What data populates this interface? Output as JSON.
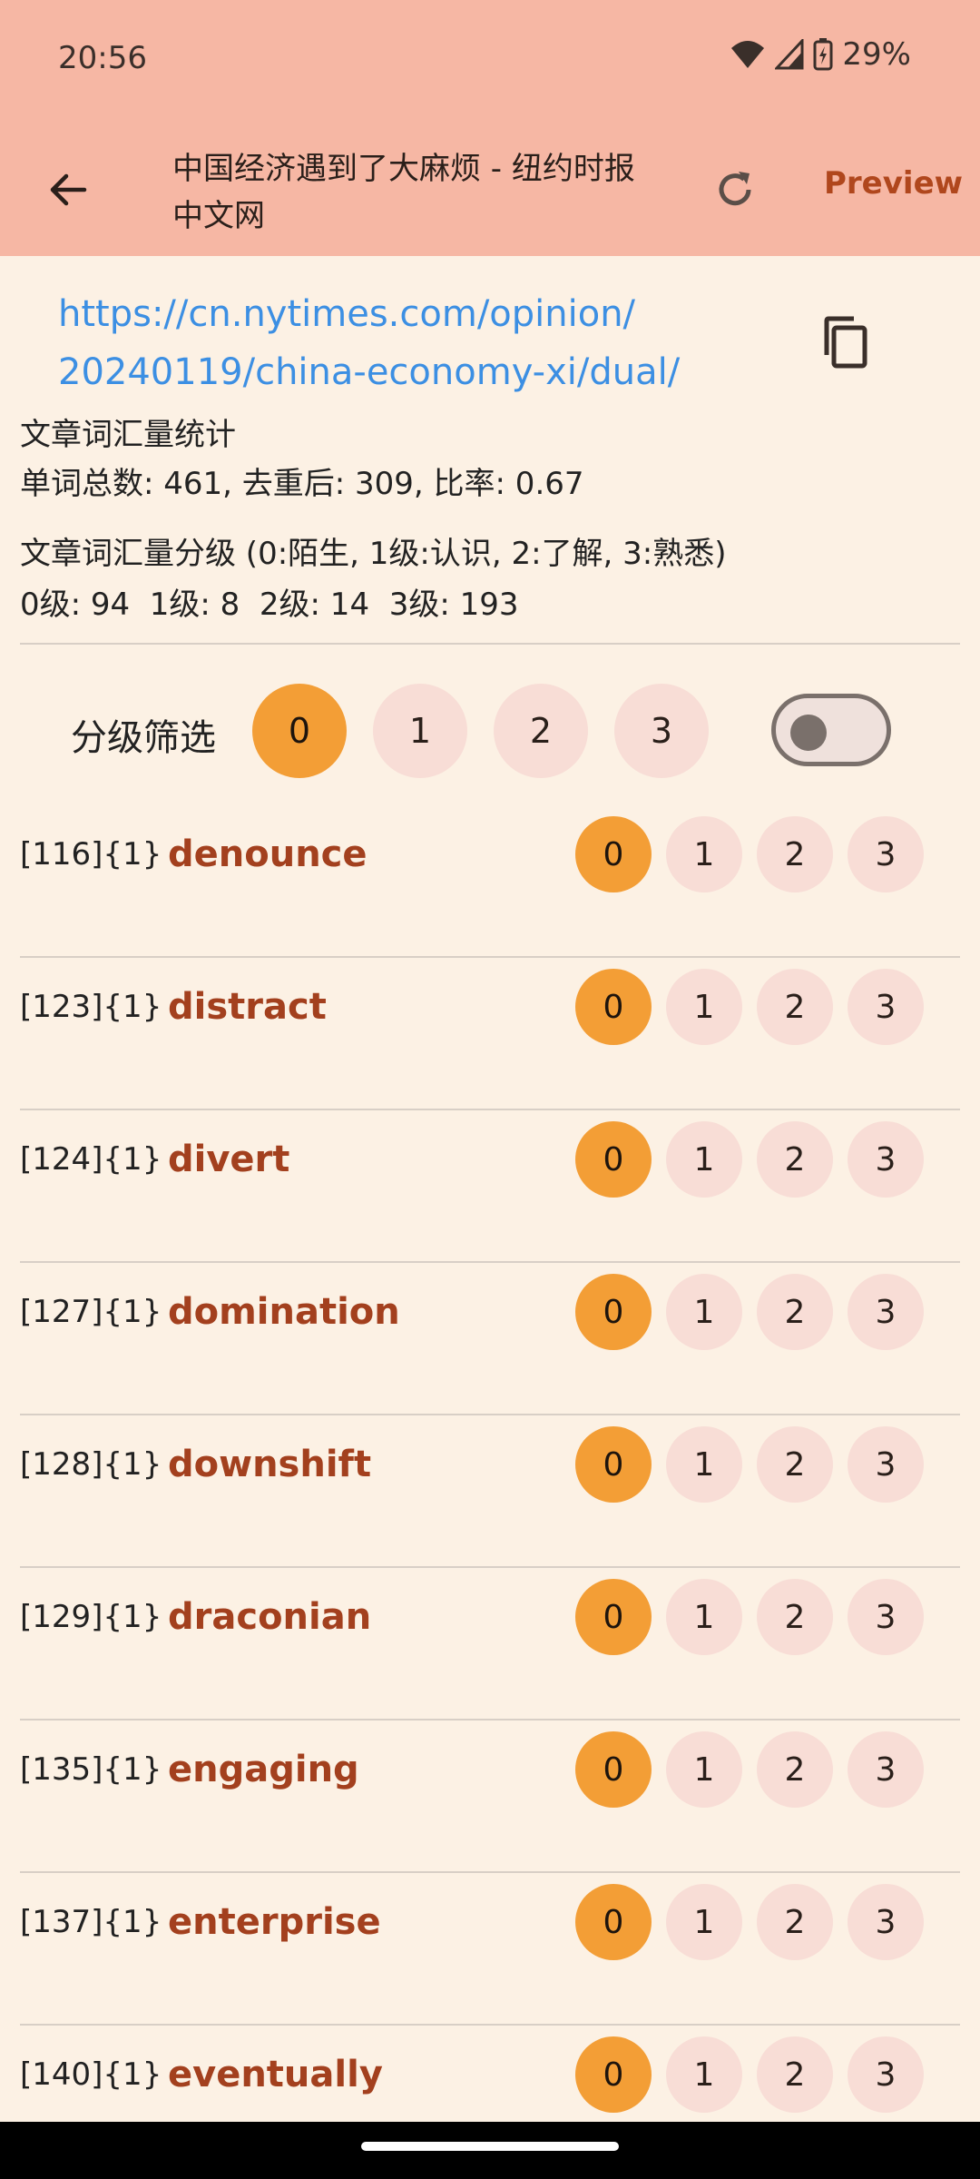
{
  "status": {
    "time": "20:56",
    "battery": "29%",
    "icons": [
      "wifi-icon",
      "signal-icon",
      "battery-icon"
    ]
  },
  "app_bar": {
    "title": "中国经济遇到了大麻烦 - 纽约时报中文网",
    "preview_label": "Preview",
    "icons": [
      "back-arrow-icon",
      "refresh-icon"
    ]
  },
  "url": {
    "text": "https://cn.nytimes.com/opinion/20240119/china-economy-xi/dual/",
    "line1": "https://cn.nytimes.com/opinion/",
    "line2": "20240119/china-economy-xi/dual/"
  },
  "stats": {
    "heading": "文章词汇量统计",
    "summary": "单词总数: 461, 去重后: 309, 比率: 0.67"
  },
  "levels": {
    "heading": "文章词汇量分级 (0:陌生, 1级:认识, 2:了解, 3:熟悉)",
    "summary": "0级: 94  1级: 8  2级: 14  3级: 193"
  },
  "filter": {
    "label": "分级筛选",
    "options": [
      "0",
      "1",
      "2",
      "3"
    ],
    "selected": "0",
    "toggle_on": false
  },
  "rows": [
    {
      "index": "[116]{1}",
      "word": "denounce",
      "level": "0"
    },
    {
      "index": "[123]{1}",
      "word": "distract",
      "level": "0"
    },
    {
      "index": "[124]{1}",
      "word": "divert",
      "level": "0"
    },
    {
      "index": "[127]{1}",
      "word": "domination",
      "level": "0"
    },
    {
      "index": "[128]{1}",
      "word": "downshift",
      "level": "0"
    },
    {
      "index": "[129]{1}",
      "word": "draconian",
      "level": "0"
    },
    {
      "index": "[135]{1}",
      "word": "engaging",
      "level": "0"
    },
    {
      "index": "[137]{1}",
      "word": "enterprise",
      "level": "0"
    },
    {
      "index": "[140]{1}",
      "word": "eventually",
      "level": "0"
    }
  ],
  "level_options": [
    "0",
    "1",
    "2",
    "3"
  ],
  "colors": {
    "header": "#f6b7a4",
    "background": "#fcf1e4",
    "accent_selected": "#f39e36",
    "chip_unselected": "#f8ddd6",
    "word": "#a3401e",
    "link": "#3c8fe3"
  }
}
